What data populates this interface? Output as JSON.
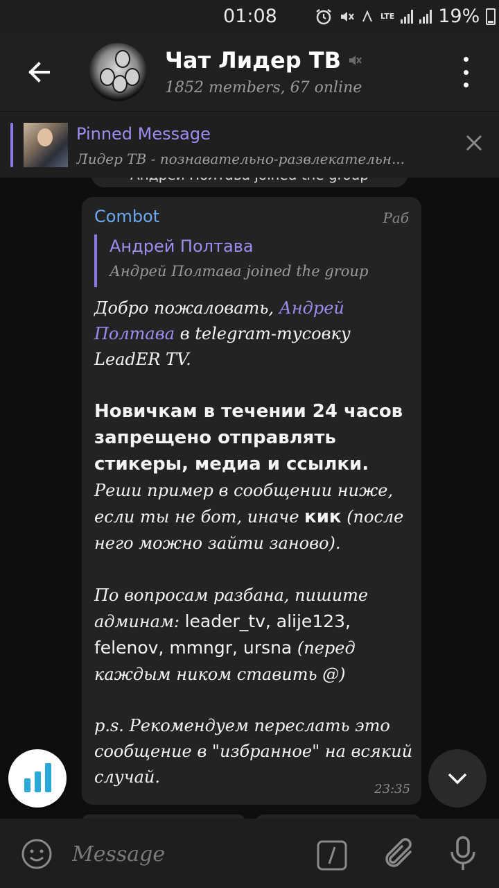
{
  "status_bar": {
    "time": "01:08",
    "lte": "LTE",
    "battery_percent": "19%"
  },
  "header": {
    "title": "Чат Лидер ТВ",
    "subtitle": "1852 members, 67 online"
  },
  "pinned": {
    "title": "Pinned Message",
    "text": "Лидер ТВ - познавательно-развлекательн..."
  },
  "service_message": "Андрей Полтава joined the group",
  "message": {
    "sender": "Combot",
    "edited_mark": "Раб",
    "reply_name": "Андрей Полтава",
    "reply_text": "Андрей Полтава joined the group",
    "welcome_prefix": "Добро пожаловать, ",
    "welcome_link": "Андрей Полтава",
    "welcome_suffix": " в telegram-тусовку LeadER TV.",
    "rules_bold": "Новичкам в течении 24 часов запрещено отправлять стикеры, медиа и ссылки.",
    "rules_text_1": " Реши пример в сообщении ниже, если ты не бот, иначе ",
    "rules_kick": "кик",
    "rules_text_2": " (после него можно зайти заново).",
    "admins_prefix": "По вопросам разбана, пишите админам: ",
    "admins_list": "leader_tv, alije123, felenov, mmngr, ursna",
    "admins_suffix": " (перед каждым ником ставить @)",
    "ps_text": "p.s. Рекомендуем переслать это сообщение в \"избранное\" на всякий случай.",
    "time": "23:35"
  },
  "input": {
    "placeholder": "Message"
  },
  "colors": {
    "accent_purple": "#a08cf0",
    "sender_blue": "#6ba8f0",
    "bubble_bg": "#232323",
    "bot_fab_blue": "#2aa8d8"
  }
}
